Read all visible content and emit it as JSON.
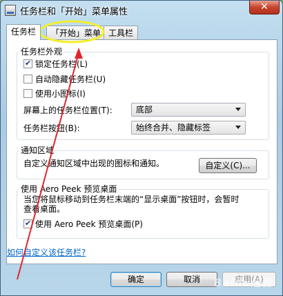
{
  "window": {
    "title": "任务栏和「开始」菜单属性",
    "close_symbol": "✕"
  },
  "tabs": [
    {
      "label": "任务栏",
      "active": true
    },
    {
      "label": "「开始」菜单",
      "active": false
    },
    {
      "label": "工具栏",
      "active": false
    }
  ],
  "appearance": {
    "title": "任务栏外观",
    "lock_taskbar": {
      "label": "锁定任务栏(L)",
      "checked": true
    },
    "auto_hide": {
      "label": "自动隐藏任务栏(U)",
      "checked": false
    },
    "small_icons": {
      "label": "使用小图标(I)",
      "checked": false
    },
    "location_label": "屏幕上的任务栏位置(T):",
    "location_value": "底部",
    "buttons_label": "任务栏按钮(B):",
    "buttons_value": "始终合并、隐藏标签"
  },
  "notification": {
    "title": "通知区域",
    "description": "自定义通知区域中出现的图标和通知。",
    "customize_button": "自定义(C)..."
  },
  "peek": {
    "title": "使用 Aero Peek 预览桌面",
    "description_line1": "当您将鼠标移动到任务栏末端的“显示桌面”按钮时，会暂时",
    "description_line2": "查看桌面。",
    "checkbox": {
      "label": "使用 Aero Peek 预览桌面(P)",
      "checked": true
    }
  },
  "help_link": "如何自定义该任务栏?",
  "footer": {
    "ok": "确定",
    "cancel": "取消",
    "apply": "应用(A)"
  },
  "annotation": {
    "ellipse_color": "#f3ef2a",
    "arrow_color": "#e0262b"
  },
  "watermark": "Baidu经验",
  "icons": {
    "window_icon": "taskbar-properties-icon",
    "checkmark": "checkmark-icon",
    "dropdown": "chevron-down-icon"
  }
}
